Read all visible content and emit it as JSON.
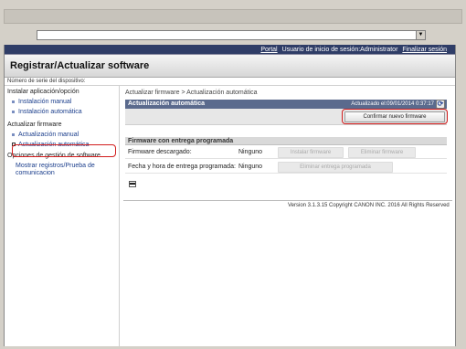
{
  "window": {
    "dropdown_glyph": "▼"
  },
  "topnav": {
    "portal": "Portal",
    "login_label": "Usuario de inicio de sesión:Administrator",
    "logout": "Finalizar sesión"
  },
  "header": {
    "title": "Registrar/Actualizar software"
  },
  "serial_label": "Número de serie del dispositivo:",
  "sidebar": {
    "sections": [
      {
        "title": "Instalar aplicación/opción",
        "items": [
          "Instalación manual",
          "Instalación automática"
        ]
      },
      {
        "title": "Actualizar firmware",
        "items": [
          "Actualización manual",
          "Actualización automática"
        ]
      },
      {
        "title": "Opciones de gestión de software",
        "items": [
          "Mostrar registros/Prueba de comunicacion"
        ]
      }
    ],
    "selected": "Actualización automática"
  },
  "main": {
    "breadcrumb": "Actualizar firmware > Actualización automática",
    "panel_title": "Actualización automática",
    "updated": "Actualizado el:09/01/2014 0:37:17",
    "refresh_icon": "refresh-icon",
    "confirm_button": "Confirmar nuevo firmware",
    "schedule_title": "Firmware con entrega programada",
    "rows": [
      {
        "label": "Firmware descargado:",
        "value": "Ninguno",
        "buttons": [
          "Instalar firmware",
          "Eliminar firmware"
        ]
      },
      {
        "label": "Fecha y hora de entrega programada:",
        "value": "Ninguno",
        "buttons": [
          "Eliminar entrega programada"
        ]
      }
    ]
  },
  "footer": {
    "copyright": "Version 3.1.3.15 Copyright CANON INC. 2016 All Rights Reserved"
  },
  "colors": {
    "nav_bg": "#2f3d67",
    "panel_head": "#5a6a8d",
    "link": "#1b3e8c",
    "highlight": "#d21d1d"
  }
}
